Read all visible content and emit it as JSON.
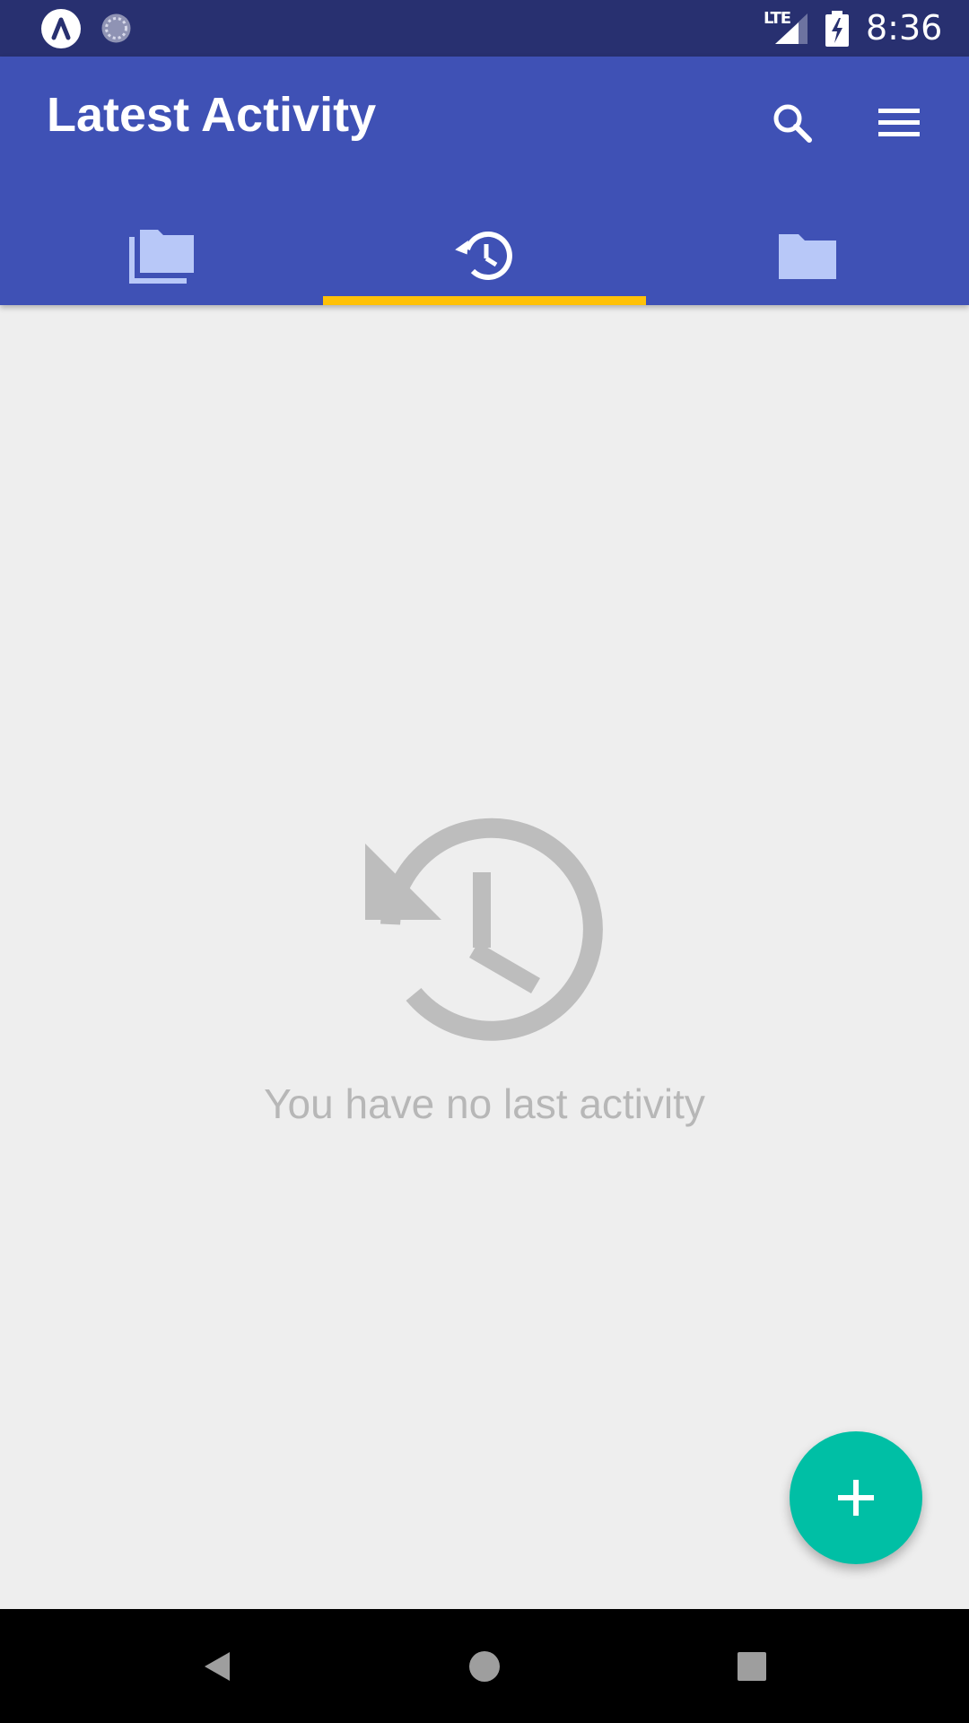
{
  "status_bar": {
    "network_type": "LTE",
    "time": "8:36"
  },
  "app_bar": {
    "title": "Latest Activity",
    "actions": {
      "search_icon": "search-icon",
      "menu_icon": "menu-icon"
    }
  },
  "tabs": [
    {
      "icon": "folders-icon",
      "selected": false
    },
    {
      "icon": "history-icon",
      "selected": true
    },
    {
      "icon": "folder-icon",
      "selected": false
    }
  ],
  "empty_state": {
    "icon": "history-icon",
    "message": "You have no last activity"
  },
  "fab": {
    "icon": "plus-icon"
  },
  "nav_bar": {
    "back_icon": "back-icon",
    "home_icon": "home-icon",
    "recents_icon": "recents-icon"
  },
  "colors": {
    "status_bar": "#283070",
    "primary": "#3f51b5",
    "tab_indicator": "#ffc107",
    "inactive_tab_icon": "#b8c8f8",
    "fab": "#00bfa5",
    "background": "#eeeeee",
    "empty_state": "#bdbdbd"
  }
}
